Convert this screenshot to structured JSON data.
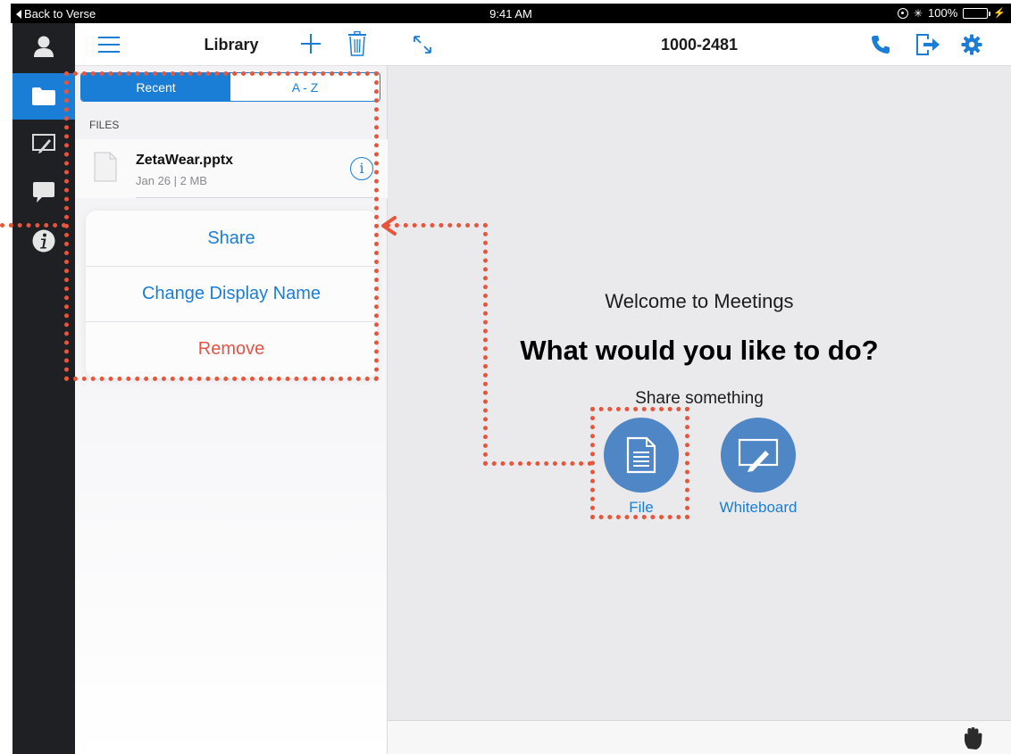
{
  "status_bar": {
    "back_label": "Back to Verse",
    "time": "9:41 AM",
    "battery": "100%"
  },
  "rail": {
    "items": [
      {
        "name": "profile-icon",
        "active": false
      },
      {
        "name": "folder-icon",
        "active": true
      },
      {
        "name": "whiteboard-icon",
        "active": false
      },
      {
        "name": "chat-icon",
        "active": false
      },
      {
        "name": "info-icon",
        "active": false
      }
    ]
  },
  "library": {
    "title": "Library",
    "segments": {
      "recent": "Recent",
      "az": "A - Z"
    },
    "section_label": "FILES",
    "file": {
      "name": "ZetaWear.pptx",
      "meta": "Jan 26 | 2 MB",
      "info_glyph": "i"
    },
    "actions": {
      "share": "Share",
      "rename": "Change Display Name",
      "remove": "Remove"
    }
  },
  "main": {
    "meeting_id": "1000-2481",
    "welcome": "Welcome to Meetings",
    "question": "What would you like to do?",
    "share_prompt": "Share something",
    "share_file_label": "File",
    "share_whiteboard_label": "Whiteboard"
  },
  "colors": {
    "accent": "#1a7ed6",
    "rail": "#1e2023",
    "danger": "#e25544",
    "share_button": "#4f86c6",
    "annotation": "#e8553a"
  }
}
